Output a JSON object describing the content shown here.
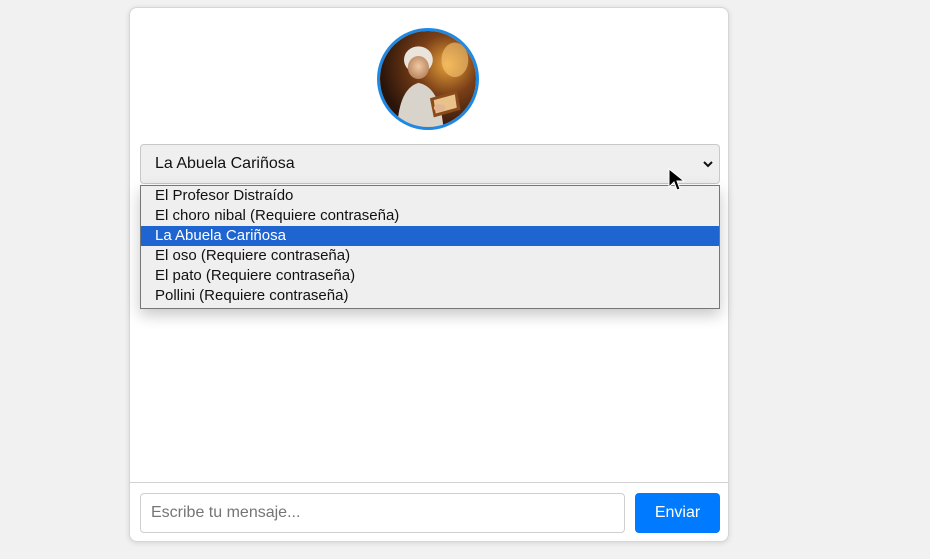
{
  "persona_select": {
    "selected_label": "La Abuela Cariñosa",
    "options": [
      "El Profesor Distraído",
      "El choro nibal (Requiere contraseña)",
      "La Abuela Cariñosa",
      "El oso (Requiere contraseña)",
      "El pato (Requiere contraseña)",
      "Pollini (Requiere contraseña)"
    ]
  },
  "message_input": {
    "placeholder": "Escribe tu mensaje...",
    "value": ""
  },
  "send_button": {
    "label": "Enviar"
  },
  "colors": {
    "accent": "#007bff",
    "avatar_border": "#1e88e5",
    "selected_option": "#1f65d1"
  },
  "icons": {
    "avatar": "grandmother-portrait-image",
    "select_arrow": "chevron-down-icon",
    "cursor": "mouse-pointer-icon"
  }
}
